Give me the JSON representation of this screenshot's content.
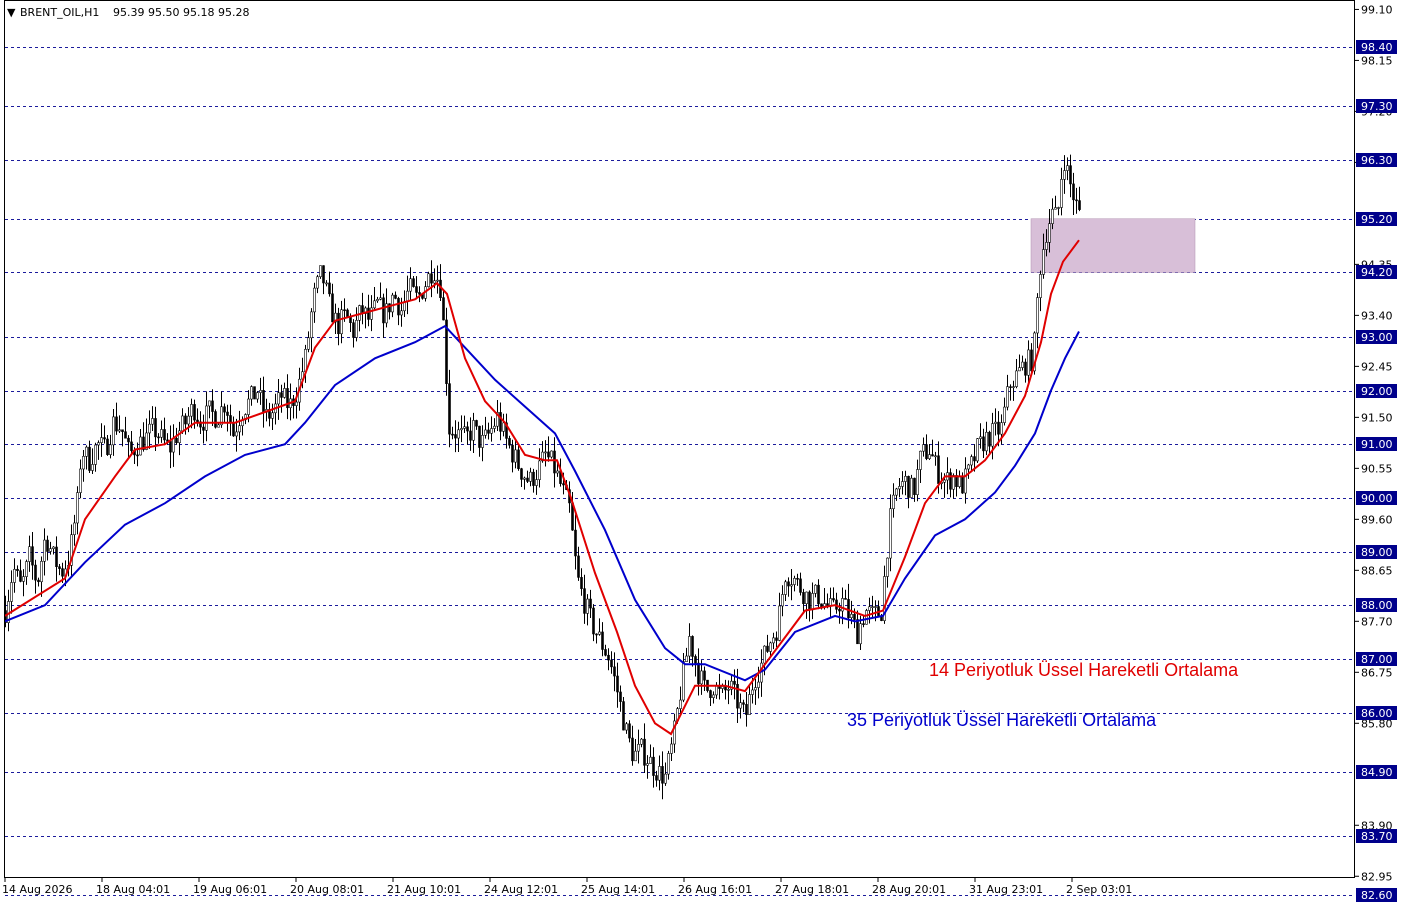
{
  "header": {
    "symbol": "BRENT_OIL,H1",
    "ohlc": "95.39 95.50 95.18 95.28"
  },
  "colors": {
    "background": "#ffffff",
    "axis": "#000000",
    "candle": "#000000",
    "ema14": "#e00000",
    "ema35": "#0000cc",
    "level_line": "#1c1c9c",
    "level_box": "#00008b",
    "zone": "#d8bfd8"
  },
  "annotations": {
    "ema14_label": "14 Periyotluk Üssel Hareketli Ortalama",
    "ema35_label": "35 Periyotluk Üssel Hareketli Ortalama"
  },
  "chart_data": {
    "type": "candlestick",
    "title": "BRENT_OIL,H1",
    "ylim": [
      82.6,
      99.2
    ],
    "price_ticks": [
      "99.10",
      "98.15",
      "97.20",
      "96.25",
      "94.35",
      "93.40",
      "92.45",
      "91.50",
      "90.55",
      "89.60",
      "88.65",
      "87.70",
      "86.75",
      "85.80",
      "83.90",
      "82.95"
    ],
    "levels": [
      98.4,
      97.3,
      96.3,
      95.2,
      94.2,
      93.0,
      92.0,
      91.0,
      90.0,
      89.0,
      88.0,
      87.0,
      86.0,
      84.9,
      83.7,
      82.6
    ],
    "level_labels": [
      "98.40",
      "97.30",
      "96.30",
      "95.20",
      "94.20",
      "93.00",
      "92.00",
      "91.00",
      "90.00",
      "89.00",
      "88.00",
      "87.00",
      "86.00",
      "84.90",
      "83.70",
      "82.60"
    ],
    "x_labels": [
      "14 Aug 2026",
      "18 Aug 04:01",
      "19 Aug 06:01",
      "20 Aug 08:01",
      "21 Aug 10:01",
      "24 Aug 12:01",
      "25 Aug 14:01",
      "26 Aug 16:01",
      "27 Aug 18:01",
      "28 Aug 20:01",
      "31 Aug 23:01",
      "2 Sep 03:01"
    ],
    "zone": {
      "from_price": 94.2,
      "to_price": 95.2
    },
    "close_path": [
      [
        0,
        87.9
      ],
      [
        8,
        88.7
      ],
      [
        16,
        88.3
      ],
      [
        24,
        88.9
      ],
      [
        32,
        88.4
      ],
      [
        40,
        89.3
      ],
      [
        48,
        88.9
      ],
      [
        56,
        88.6
      ],
      [
        64,
        88.9
      ],
      [
        72,
        89.9
      ],
      [
        76,
        90.9
      ],
      [
        84,
        90.7
      ],
      [
        92,
        91.0
      ],
      [
        100,
        90.9
      ],
      [
        108,
        91.4
      ],
      [
        116,
        91.3
      ],
      [
        124,
        90.8
      ],
      [
        132,
        91.0
      ],
      [
        140,
        91.1
      ],
      [
        148,
        91.3
      ],
      [
        156,
        91.1
      ],
      [
        164,
        90.9
      ],
      [
        172,
        91.2
      ],
      [
        180,
        91.4
      ],
      [
        188,
        91.7
      ],
      [
        196,
        91.4
      ],
      [
        204,
        91.6
      ],
      [
        212,
        91.5
      ],
      [
        220,
        91.8
      ],
      [
        228,
        91.2
      ],
      [
        236,
        91.6
      ],
      [
        244,
        91.8
      ],
      [
        252,
        92.0
      ],
      [
        260,
        91.5
      ],
      [
        268,
        91.6
      ],
      [
        276,
        91.9
      ],
      [
        284,
        91.7
      ],
      [
        292,
        92.0
      ],
      [
        300,
        92.6
      ],
      [
        308,
        93.7
      ],
      [
        316,
        94.2
      ],
      [
        324,
        93.6
      ],
      [
        332,
        93.2
      ],
      [
        340,
        93.4
      ],
      [
        348,
        93.1
      ],
      [
        356,
        93.5
      ],
      [
        364,
        93.3
      ],
      [
        372,
        93.6
      ],
      [
        380,
        93.4
      ],
      [
        388,
        93.8
      ],
      [
        396,
        93.5
      ],
      [
        404,
        93.9
      ],
      [
        412,
        93.7
      ],
      [
        420,
        94.0
      ],
      [
        428,
        94.3
      ],
      [
        436,
        93.9
      ],
      [
        444,
        91.3
      ],
      [
        452,
        91.2
      ],
      [
        460,
        91.1
      ],
      [
        468,
        91.3
      ],
      [
        476,
        91.0
      ],
      [
        484,
        91.2
      ],
      [
        492,
        91.5
      ],
      [
        500,
        91.1
      ],
      [
        508,
        90.8
      ],
      [
        516,
        90.5
      ],
      [
        524,
        90.3
      ],
      [
        532,
        90.5
      ],
      [
        540,
        90.8
      ],
      [
        548,
        90.6
      ],
      [
        556,
        90.2
      ],
      [
        564,
        89.8
      ],
      [
        572,
        88.5
      ],
      [
        580,
        88.0
      ],
      [
        588,
        87.6
      ],
      [
        596,
        87.3
      ],
      [
        604,
        87.0
      ],
      [
        612,
        86.4
      ],
      [
        620,
        85.7
      ],
      [
        628,
        85.2
      ],
      [
        636,
        85.3
      ],
      [
        644,
        85.1
      ],
      [
        652,
        84.9
      ],
      [
        660,
        84.8
      ],
      [
        668,
        85.5
      ],
      [
        676,
        86.5
      ],
      [
        684,
        87.4
      ],
      [
        692,
        86.8
      ],
      [
        700,
        86.4
      ],
      [
        708,
        86.5
      ],
      [
        716,
        86.3
      ],
      [
        724,
        86.5
      ],
      [
        732,
        86.2
      ],
      [
        740,
        85.9
      ],
      [
        748,
        86.6
      ],
      [
        756,
        86.9
      ],
      [
        764,
        87.3
      ],
      [
        772,
        87.6
      ],
      [
        780,
        88.6
      ],
      [
        788,
        88.5
      ],
      [
        796,
        88.3
      ],
      [
        804,
        88.1
      ],
      [
        812,
        88.2
      ],
      [
        820,
        88.0
      ],
      [
        828,
        87.9
      ],
      [
        836,
        88.1
      ],
      [
        844,
        87.8
      ],
      [
        852,
        87.5
      ],
      [
        860,
        87.9
      ],
      [
        868,
        87.8
      ],
      [
        876,
        87.9
      ],
      [
        884,
        89.5
      ],
      [
        892,
        90.2
      ],
      [
        900,
        90.3
      ],
      [
        908,
        90.1
      ],
      [
        916,
        90.8
      ],
      [
        924,
        90.9
      ],
      [
        932,
        90.5
      ],
      [
        940,
        90.3
      ],
      [
        948,
        90.4
      ],
      [
        956,
        90.2
      ],
      [
        964,
        90.5
      ],
      [
        972,
        90.9
      ],
      [
        980,
        91.1
      ],
      [
        988,
        91.2
      ],
      [
        996,
        91.3
      ],
      [
        1004,
        92.1
      ],
      [
        1012,
        92.3
      ],
      [
        1020,
        92.5
      ],
      [
        1028,
        92.6
      ],
      [
        1034,
        94.2
      ],
      [
        1040,
        94.9
      ],
      [
        1046,
        95.3
      ],
      [
        1052,
        95.2
      ],
      [
        1058,
        96.4
      ],
      [
        1064,
        95.9
      ],
      [
        1070,
        95.5
      ],
      [
        1074,
        95.28
      ]
    ],
    "ema14": [
      [
        0,
        87.8
      ],
      [
        60,
        88.5
      ],
      [
        80,
        89.6
      ],
      [
        110,
        90.4
      ],
      [
        130,
        90.9
      ],
      [
        160,
        91.0
      ],
      [
        190,
        91.4
      ],
      [
        230,
        91.4
      ],
      [
        260,
        91.6
      ],
      [
        290,
        91.8
      ],
      [
        310,
        92.8
      ],
      [
        330,
        93.3
      ],
      [
        370,
        93.5
      ],
      [
        410,
        93.7
      ],
      [
        432,
        94.0
      ],
      [
        442,
        93.8
      ],
      [
        460,
        92.6
      ],
      [
        480,
        91.8
      ],
      [
        500,
        91.4
      ],
      [
        520,
        90.8
      ],
      [
        540,
        90.7
      ],
      [
        552,
        90.7
      ],
      [
        566,
        90.0
      ],
      [
        590,
        88.6
      ],
      [
        612,
        87.5
      ],
      [
        630,
        86.5
      ],
      [
        650,
        85.8
      ],
      [
        666,
        85.6
      ],
      [
        690,
        86.5
      ],
      [
        720,
        86.5
      ],
      [
        740,
        86.4
      ],
      [
        760,
        86.9
      ],
      [
        780,
        87.4
      ],
      [
        800,
        87.9
      ],
      [
        830,
        88.0
      ],
      [
        860,
        87.8
      ],
      [
        878,
        87.9
      ],
      [
        900,
        88.9
      ],
      [
        920,
        89.9
      ],
      [
        940,
        90.4
      ],
      [
        960,
        90.4
      ],
      [
        980,
        90.7
      ],
      [
        1000,
        91.2
      ],
      [
        1020,
        91.9
      ],
      [
        1036,
        92.9
      ],
      [
        1046,
        93.8
      ],
      [
        1058,
        94.4
      ],
      [
        1074,
        94.8
      ]
    ],
    "ema35": [
      [
        0,
        87.7
      ],
      [
        40,
        88.0
      ],
      [
        80,
        88.8
      ],
      [
        120,
        89.5
      ],
      [
        160,
        89.9
      ],
      [
        200,
        90.4
      ],
      [
        240,
        90.8
      ],
      [
        280,
        91.0
      ],
      [
        300,
        91.4
      ],
      [
        330,
        92.1
      ],
      [
        370,
        92.6
      ],
      [
        410,
        92.9
      ],
      [
        440,
        93.2
      ],
      [
        460,
        92.8
      ],
      [
        490,
        92.2
      ],
      [
        520,
        91.7
      ],
      [
        550,
        91.2
      ],
      [
        570,
        90.5
      ],
      [
        600,
        89.4
      ],
      [
        630,
        88.1
      ],
      [
        660,
        87.2
      ],
      [
        680,
        86.9
      ],
      [
        700,
        86.9
      ],
      [
        740,
        86.6
      ],
      [
        760,
        86.8
      ],
      [
        790,
        87.5
      ],
      [
        830,
        87.8
      ],
      [
        850,
        87.7
      ],
      [
        878,
        87.8
      ],
      [
        900,
        88.5
      ],
      [
        930,
        89.3
      ],
      [
        960,
        89.6
      ],
      [
        990,
        90.1
      ],
      [
        1010,
        90.6
      ],
      [
        1030,
        91.2
      ],
      [
        1046,
        92.0
      ],
      [
        1060,
        92.6
      ],
      [
        1074,
        93.1
      ]
    ]
  }
}
